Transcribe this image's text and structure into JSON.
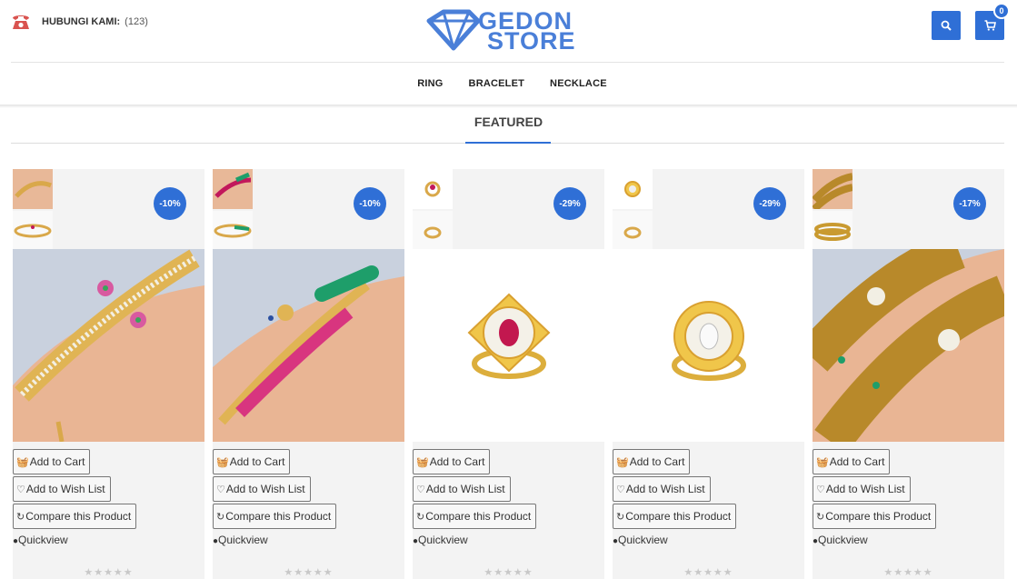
{
  "header": {
    "contact_label": "HUBUNGI KAMI:",
    "contact_value": "(123)",
    "logo_line1": "GEDON",
    "logo_line2": "STORE",
    "cart_count": "0"
  },
  "icons": {
    "phone": "phone-icon",
    "search": "search-icon",
    "cart": "cart-icon",
    "add_to_cart": "basket-icon",
    "wishlist": "heart-icon",
    "compare": "refresh-icon",
    "quickview": "eye-icon"
  },
  "colors": {
    "accent": "#2f6fd6",
    "phone_icon": "#d9534f"
  },
  "nav": {
    "items": [
      "RING",
      "BRACELET",
      "NECKLACE"
    ]
  },
  "section": {
    "title": "FEATURED"
  },
  "labels": {
    "add_to_cart": "Add to Cart",
    "add_to_wishlist": "Add to Wish List",
    "compare": "Compare this Product",
    "quickview": "Quickview",
    "rating": "★★★★★"
  },
  "products": [
    {
      "discount": "-10%",
      "type": "bracelet-pearl"
    },
    {
      "discount": "-10%",
      "type": "bracelet-peacock"
    },
    {
      "discount": "-29%",
      "type": "ring-ruby"
    },
    {
      "discount": "-29%",
      "type": "ring-diamond"
    },
    {
      "discount": "-17%",
      "type": "bangle-gold"
    }
  ]
}
